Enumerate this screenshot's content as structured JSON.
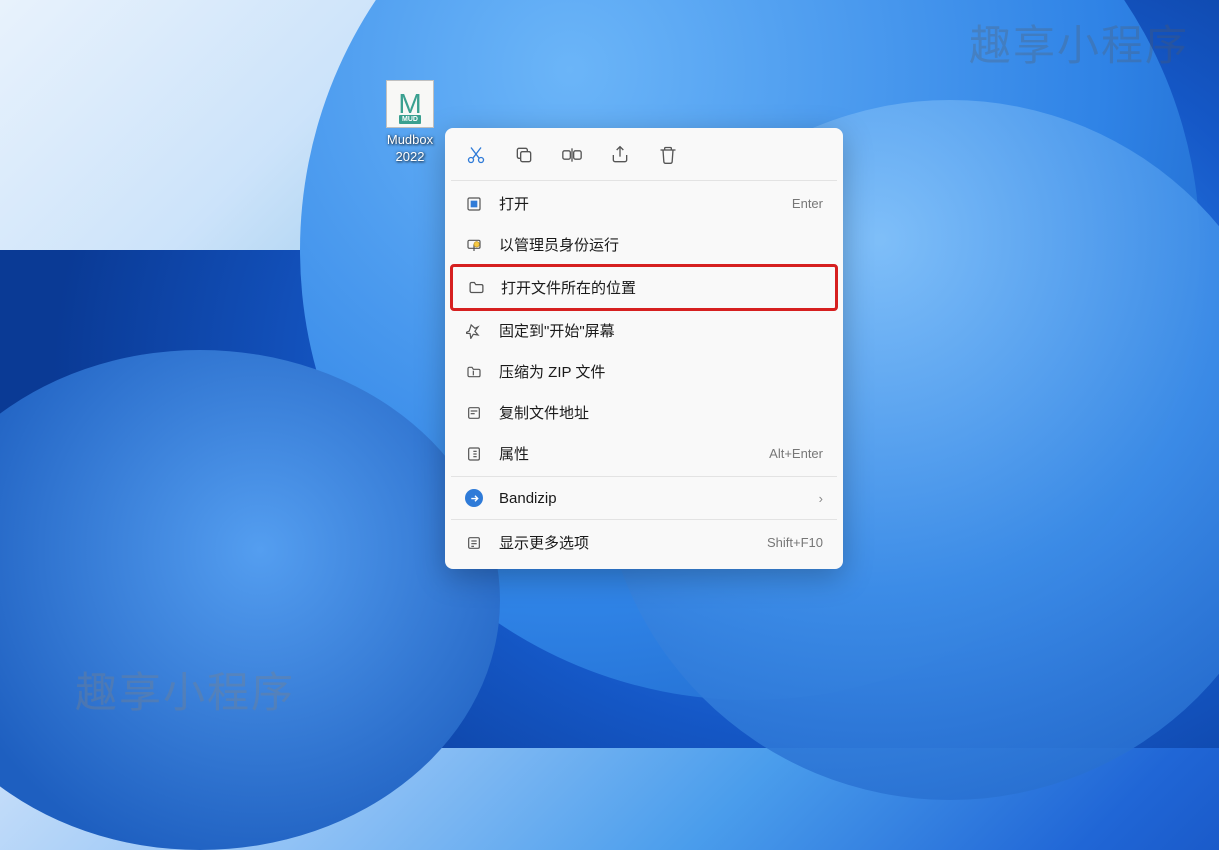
{
  "watermarks": {
    "top_right": "趣享小程序",
    "center": "趣享小程序",
    "bottom_left": "趣享小程序"
  },
  "desktop_icon": {
    "letter": "M",
    "sublabel": "MUD",
    "label_line1": "Mudbox",
    "label_line2": "2022"
  },
  "context_menu": {
    "toolbar": {
      "cut": "cut",
      "copy": "copy",
      "rename": "rename",
      "share": "share",
      "delete": "delete"
    },
    "items": [
      {
        "label": "打开",
        "shortcut": "Enter",
        "icon": "open"
      },
      {
        "label": "以管理员身份运行",
        "shortcut": "",
        "icon": "shield"
      },
      {
        "label": "打开文件所在的位置",
        "shortcut": "",
        "icon": "folder",
        "highlighted": true
      },
      {
        "label": "固定到\"开始\"屏幕",
        "shortcut": "",
        "icon": "pin"
      },
      {
        "label": "压缩为 ZIP 文件",
        "shortcut": "",
        "icon": "zip"
      },
      {
        "label": "复制文件地址",
        "shortcut": "",
        "icon": "path"
      },
      {
        "label": "属性",
        "shortcut": "Alt+Enter",
        "icon": "properties"
      }
    ],
    "app_item": {
      "label": "Bandizip",
      "submenu": true
    },
    "more_item": {
      "label": "显示更多选项",
      "shortcut": "Shift+F10"
    }
  }
}
